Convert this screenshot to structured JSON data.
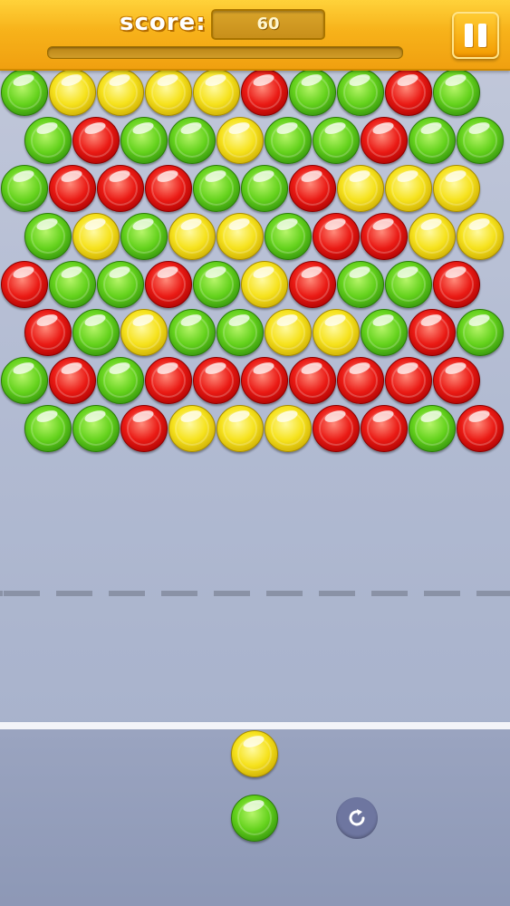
{
  "hud": {
    "score_label": "score:",
    "score_value": "60",
    "progress_fraction": 0.0,
    "pause_icon": "pause-icon"
  },
  "board": {
    "rows": [
      [
        "green",
        "yellow",
        "yellow",
        "yellow",
        "yellow",
        "red",
        "green",
        "green",
        "red",
        "green"
      ],
      [
        "green",
        "red",
        "green",
        "green",
        "yellow",
        "green",
        "green",
        "red",
        "green",
        "green"
      ],
      [
        "green",
        "red",
        "red",
        "red",
        "green",
        "green",
        "red",
        "yellow",
        "yellow",
        "yellow"
      ],
      [
        "green",
        "yellow",
        "green",
        "yellow",
        "yellow",
        "green",
        "red",
        "red",
        "yellow",
        "yellow"
      ],
      [
        "red",
        "green",
        "green",
        "red",
        "green",
        "yellow",
        "red",
        "green",
        "green",
        "red"
      ],
      [
        "red",
        "green",
        "yellow",
        "green",
        "green",
        "yellow",
        "yellow",
        "green",
        "red",
        "green"
      ],
      [
        "green",
        "red",
        "green",
        "red",
        "red",
        "red",
        "red",
        "red",
        "red",
        "red"
      ],
      [
        "green",
        "green",
        "red",
        "yellow",
        "yellow",
        "yellow",
        "red",
        "red",
        "green",
        "red"
      ]
    ]
  },
  "launcher": {
    "next_bubble": "yellow",
    "current_bubble": "green",
    "swap_icon": "refresh-icon"
  },
  "colors": {
    "green": "#4fbf14",
    "yellow": "#f2dc10",
    "red": "#e01510",
    "topbar": "#f7b21a",
    "background": "#b2bbd2"
  }
}
